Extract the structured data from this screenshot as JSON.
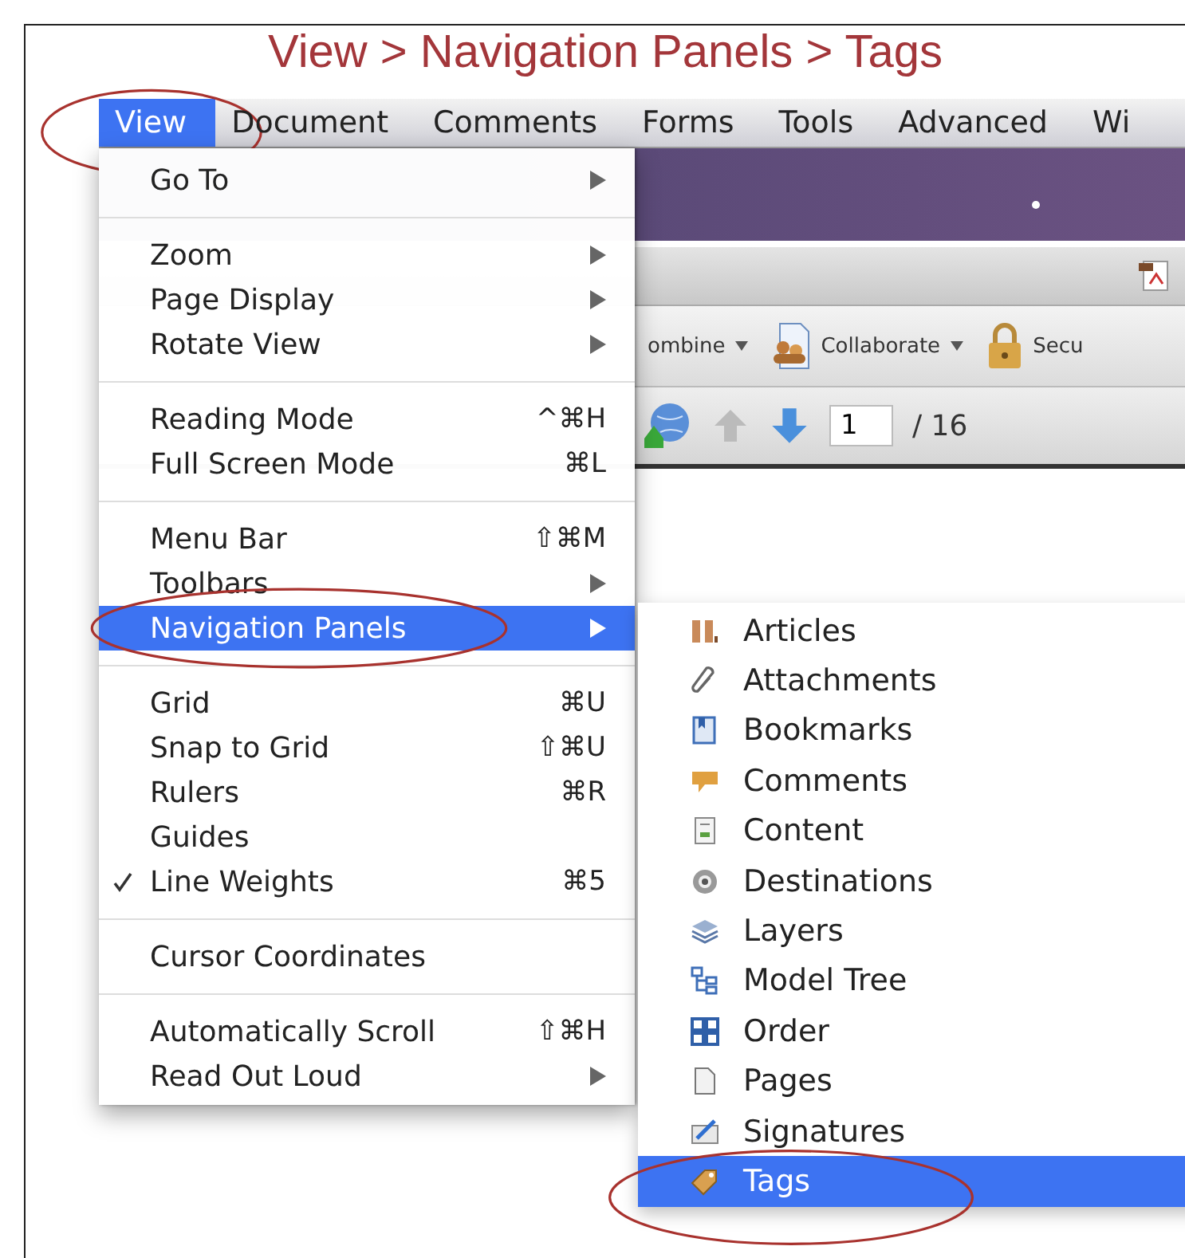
{
  "title": "View > Navigation Panels > Tags",
  "menubar": [
    {
      "label": "View",
      "selected": true,
      "circled": true
    },
    {
      "label": "Document",
      "selected": false,
      "circled": false
    },
    {
      "label": "Comments",
      "selected": false,
      "circled": false
    },
    {
      "label": "Forms",
      "selected": false,
      "circled": false
    },
    {
      "label": "Tools",
      "selected": false,
      "circled": false
    },
    {
      "label": "Advanced",
      "selected": false,
      "circled": false
    },
    {
      "label": "Wi",
      "selected": false,
      "circled": false
    }
  ],
  "toolbar": [
    {
      "label": "ombine",
      "dropdown": true
    },
    {
      "label": "Collaborate",
      "dropdown": true
    },
    {
      "label": "Secu",
      "dropdown": false
    }
  ],
  "page_navigation": {
    "page": "1",
    "page_count": "/ 16"
  },
  "view_menu": [
    {
      "kind": "item",
      "label": "Go To",
      "submenu": true,
      "checked": false,
      "selected": false,
      "circled": false
    },
    {
      "kind": "separator"
    },
    {
      "kind": "item",
      "label": "Zoom",
      "submenu": true,
      "checked": false,
      "selected": false,
      "circled": false
    },
    {
      "kind": "item",
      "label": "Page Display",
      "submenu": true,
      "checked": false,
      "selected": false,
      "circled": false
    },
    {
      "kind": "item",
      "label": "Rotate View",
      "submenu": true,
      "checked": false,
      "selected": false,
      "circled": false
    },
    {
      "kind": "separator"
    },
    {
      "kind": "item",
      "label": "Reading Mode",
      "shortcut": "^⌘H",
      "submenu": false,
      "checked": false,
      "selected": false,
      "circled": false
    },
    {
      "kind": "item",
      "label": "Full Screen Mode",
      "shortcut": "⌘L",
      "submenu": false,
      "checked": false,
      "selected": false,
      "circled": false
    },
    {
      "kind": "separator"
    },
    {
      "kind": "item",
      "label": "Menu Bar",
      "shortcut": "⇧⌘M",
      "submenu": false,
      "checked": false,
      "selected": false,
      "circled": false
    },
    {
      "kind": "item",
      "label": "Toolbars",
      "submenu": true,
      "checked": false,
      "selected": false,
      "circled": false
    },
    {
      "kind": "item",
      "label": "Navigation Panels",
      "submenu": true,
      "checked": false,
      "selected": true,
      "circled": true
    },
    {
      "kind": "separator"
    },
    {
      "kind": "item",
      "label": "Grid",
      "shortcut": "⌘U",
      "submenu": false,
      "checked": false,
      "selected": false,
      "circled": false
    },
    {
      "kind": "item",
      "label": "Snap to Grid",
      "shortcut": "⇧⌘U",
      "submenu": false,
      "checked": false,
      "selected": false,
      "circled": false
    },
    {
      "kind": "item",
      "label": "Rulers",
      "shortcut": "⌘R",
      "submenu": false,
      "checked": false,
      "selected": false,
      "circled": false
    },
    {
      "kind": "item",
      "label": "Guides",
      "submenu": false,
      "checked": false,
      "selected": false,
      "circled": false
    },
    {
      "kind": "item",
      "label": "Line Weights",
      "shortcut": "⌘5",
      "submenu": false,
      "checked": true,
      "selected": false,
      "circled": false
    },
    {
      "kind": "separator"
    },
    {
      "kind": "item",
      "label": "Cursor Coordinates",
      "submenu": false,
      "checked": false,
      "selected": false,
      "circled": false
    },
    {
      "kind": "separator"
    },
    {
      "kind": "item",
      "label": "Automatically Scroll",
      "shortcut": "⇧⌘H",
      "submenu": false,
      "checked": false,
      "selected": false,
      "circled": false
    },
    {
      "kind": "item",
      "label": "Read Out Loud",
      "submenu": true,
      "checked": false,
      "selected": false,
      "circled": false
    }
  ],
  "navigation_panels_menu": [
    {
      "label": "Articles",
      "selected": false,
      "circled": false
    },
    {
      "label": "Attachments",
      "selected": false,
      "circled": false
    },
    {
      "label": "Bookmarks",
      "selected": false,
      "circled": false
    },
    {
      "label": "Comments",
      "selected": false,
      "circled": false
    },
    {
      "label": "Content",
      "selected": false,
      "circled": false
    },
    {
      "label": "Destinations",
      "selected": false,
      "circled": false
    },
    {
      "label": "Layers",
      "selected": false,
      "circled": false
    },
    {
      "label": "Model Tree",
      "selected": false,
      "circled": false
    },
    {
      "label": "Order",
      "selected": false,
      "circled": false
    },
    {
      "label": "Pages",
      "selected": false,
      "circled": false
    },
    {
      "label": "Signatures",
      "selected": false,
      "circled": false
    },
    {
      "label": "Tags",
      "selected": true,
      "circled": true
    }
  ]
}
